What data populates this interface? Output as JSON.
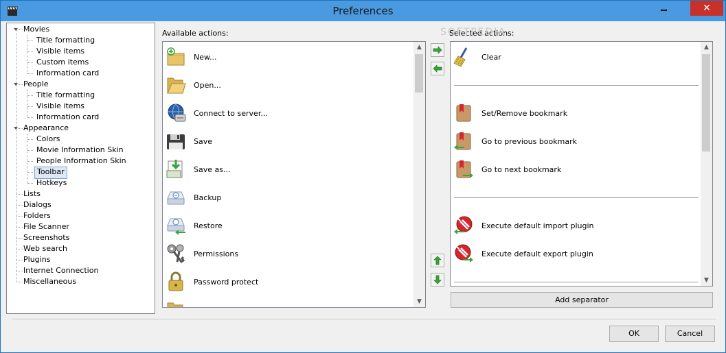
{
  "window": {
    "title": "Preferences",
    "close_glyph": "✕"
  },
  "tree": {
    "items": [
      {
        "label": "Movies",
        "level": 0,
        "expanded": true
      },
      {
        "label": "Title formatting",
        "level": 1
      },
      {
        "label": "Visible items",
        "level": 1
      },
      {
        "label": "Custom items",
        "level": 1
      },
      {
        "label": "Information card",
        "level": 1
      },
      {
        "label": "People",
        "level": 0,
        "expanded": true
      },
      {
        "label": "Title formatting",
        "level": 1
      },
      {
        "label": "Visible items",
        "level": 1
      },
      {
        "label": "Information card",
        "level": 1
      },
      {
        "label": "Appearance",
        "level": 0,
        "expanded": true
      },
      {
        "label": "Colors",
        "level": 1
      },
      {
        "label": "Movie Information Skin",
        "level": 1
      },
      {
        "label": "People Information Skin",
        "level": 1
      },
      {
        "label": "Toolbar",
        "level": 1,
        "selected": true
      },
      {
        "label": "Hotkeys",
        "level": 1
      },
      {
        "label": "Lists",
        "level": 0
      },
      {
        "label": "Dialogs",
        "level": 0
      },
      {
        "label": "Folders",
        "level": 0
      },
      {
        "label": "File Scanner",
        "level": 0
      },
      {
        "label": "Screenshots",
        "level": 0
      },
      {
        "label": "Web search",
        "level": 0
      },
      {
        "label": "Plugins",
        "level": 0
      },
      {
        "label": "Internet Connection",
        "level": 0
      },
      {
        "label": "Miscellaneous",
        "level": 0
      }
    ]
  },
  "available": {
    "label": "Available actions:",
    "items": [
      {
        "label": "New...",
        "icon": "folder-new-icon"
      },
      {
        "label": "Open...",
        "icon": "folder-open-icon"
      },
      {
        "label": "Connect to server...",
        "icon": "globe-server-icon"
      },
      {
        "label": "Save",
        "icon": "floppy-disk-icon"
      },
      {
        "label": "Save as...",
        "icon": "save-as-icon"
      },
      {
        "label": "Backup",
        "icon": "backup-drive-icon"
      },
      {
        "label": "Restore",
        "icon": "restore-drive-icon"
      },
      {
        "label": "Permissions",
        "icon": "keys-icon"
      },
      {
        "label": "Password protect",
        "icon": "padlock-icon"
      }
    ]
  },
  "selected": {
    "label": "Selected actions:",
    "items": [
      {
        "type": "action",
        "label": "Clear",
        "icon": "broom-icon"
      },
      {
        "type": "separator"
      },
      {
        "type": "action",
        "label": "Set/Remove bookmark",
        "icon": "bookmark-icon"
      },
      {
        "type": "action",
        "label": "Go to previous bookmark",
        "icon": "bookmark-prev-icon"
      },
      {
        "type": "action",
        "label": "Go to next bookmark",
        "icon": "bookmark-next-icon"
      },
      {
        "type": "separator"
      },
      {
        "type": "action",
        "label": "Execute default import plugin",
        "icon": "plugin-import-icon"
      },
      {
        "type": "action",
        "label": "Execute default export plugin",
        "icon": "plugin-export-icon"
      },
      {
        "type": "separator"
      }
    ]
  },
  "buttons": {
    "add_separator": "Add separator",
    "ok": "OK",
    "cancel": "Cancel"
  },
  "watermark": "SOFTPEDIA",
  "colors": {
    "titlebar": "#4a9ae2",
    "close": "#c7312a",
    "arrow_green": "#3aa53a",
    "selection": "#dce8f5"
  }
}
